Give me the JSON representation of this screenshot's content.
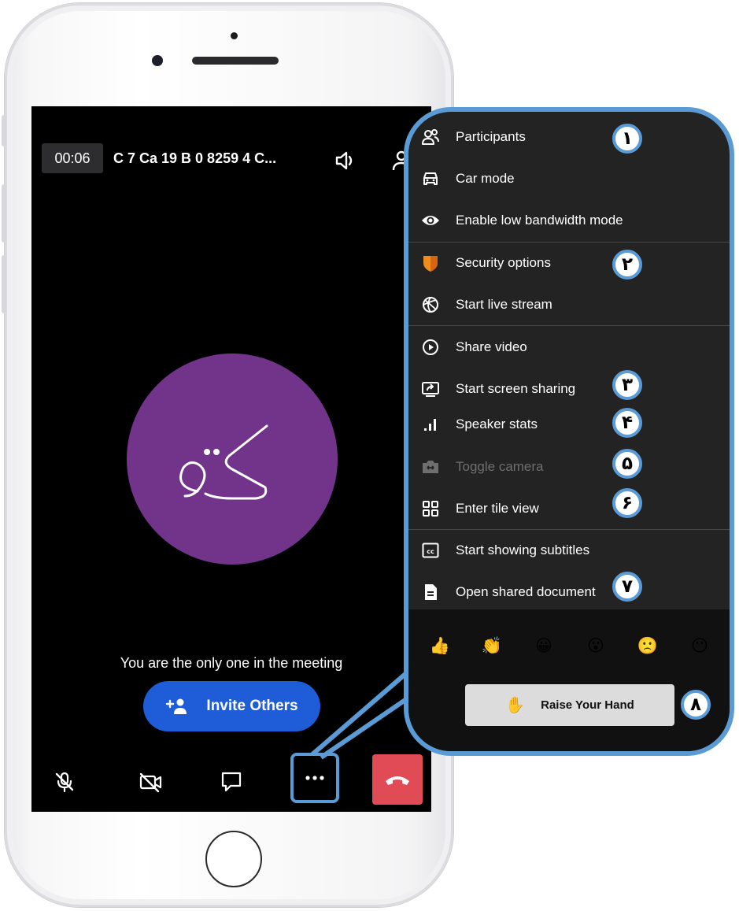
{
  "meeting": {
    "timer": "00:06",
    "room_name": "C 7 Ca 19 B 0 8259 4 C...",
    "avatar_initials": "کق",
    "status_text": "You are the only one in the meeting",
    "invite_label": "Invite Others"
  },
  "toolbar": {
    "icons": [
      "mic-muted-icon",
      "camera-off-icon",
      "chat-icon",
      "more-icon",
      "hangup-icon"
    ]
  },
  "menu": {
    "items": [
      {
        "label": "Participants",
        "icon": "participants-icon"
      },
      {
        "label": "Car mode",
        "icon": "car-icon"
      },
      {
        "label": "Enable low bandwidth mode",
        "icon": "eye-icon"
      },
      {
        "label": "Security options",
        "icon": "shield-icon"
      },
      {
        "label": "Start live stream",
        "icon": "live-stream-icon"
      },
      {
        "label": "Share video",
        "icon": "play-icon"
      },
      {
        "label": "Start screen sharing",
        "icon": "screen-share-icon"
      },
      {
        "label": "Speaker stats",
        "icon": "stats-icon"
      },
      {
        "label": "Toggle camera",
        "icon": "camera-switch-icon",
        "disabled": true
      },
      {
        "label": "Enter tile view",
        "icon": "tile-icon"
      },
      {
        "label": "Start showing subtitles",
        "icon": "subtitles-icon"
      },
      {
        "label": "Open shared document",
        "icon": "document-icon"
      }
    ],
    "reactions": [
      "👍",
      "👏",
      "😀",
      "😮",
      "🙁",
      "😶"
    ],
    "raise_hand_emoji": "✋",
    "raise_hand_label": "Raise Your Hand"
  },
  "badges": [
    "١",
    "٢",
    "٣",
    "۴",
    "۵",
    "۶",
    "٧",
    "٨"
  ],
  "colors": {
    "callout_blue": "#5b9bd5",
    "avatar_purple": "#72348a",
    "invite_blue": "#1f5cd8",
    "hangup_red": "#e14b56",
    "shield_orange": "#f08c1e"
  }
}
